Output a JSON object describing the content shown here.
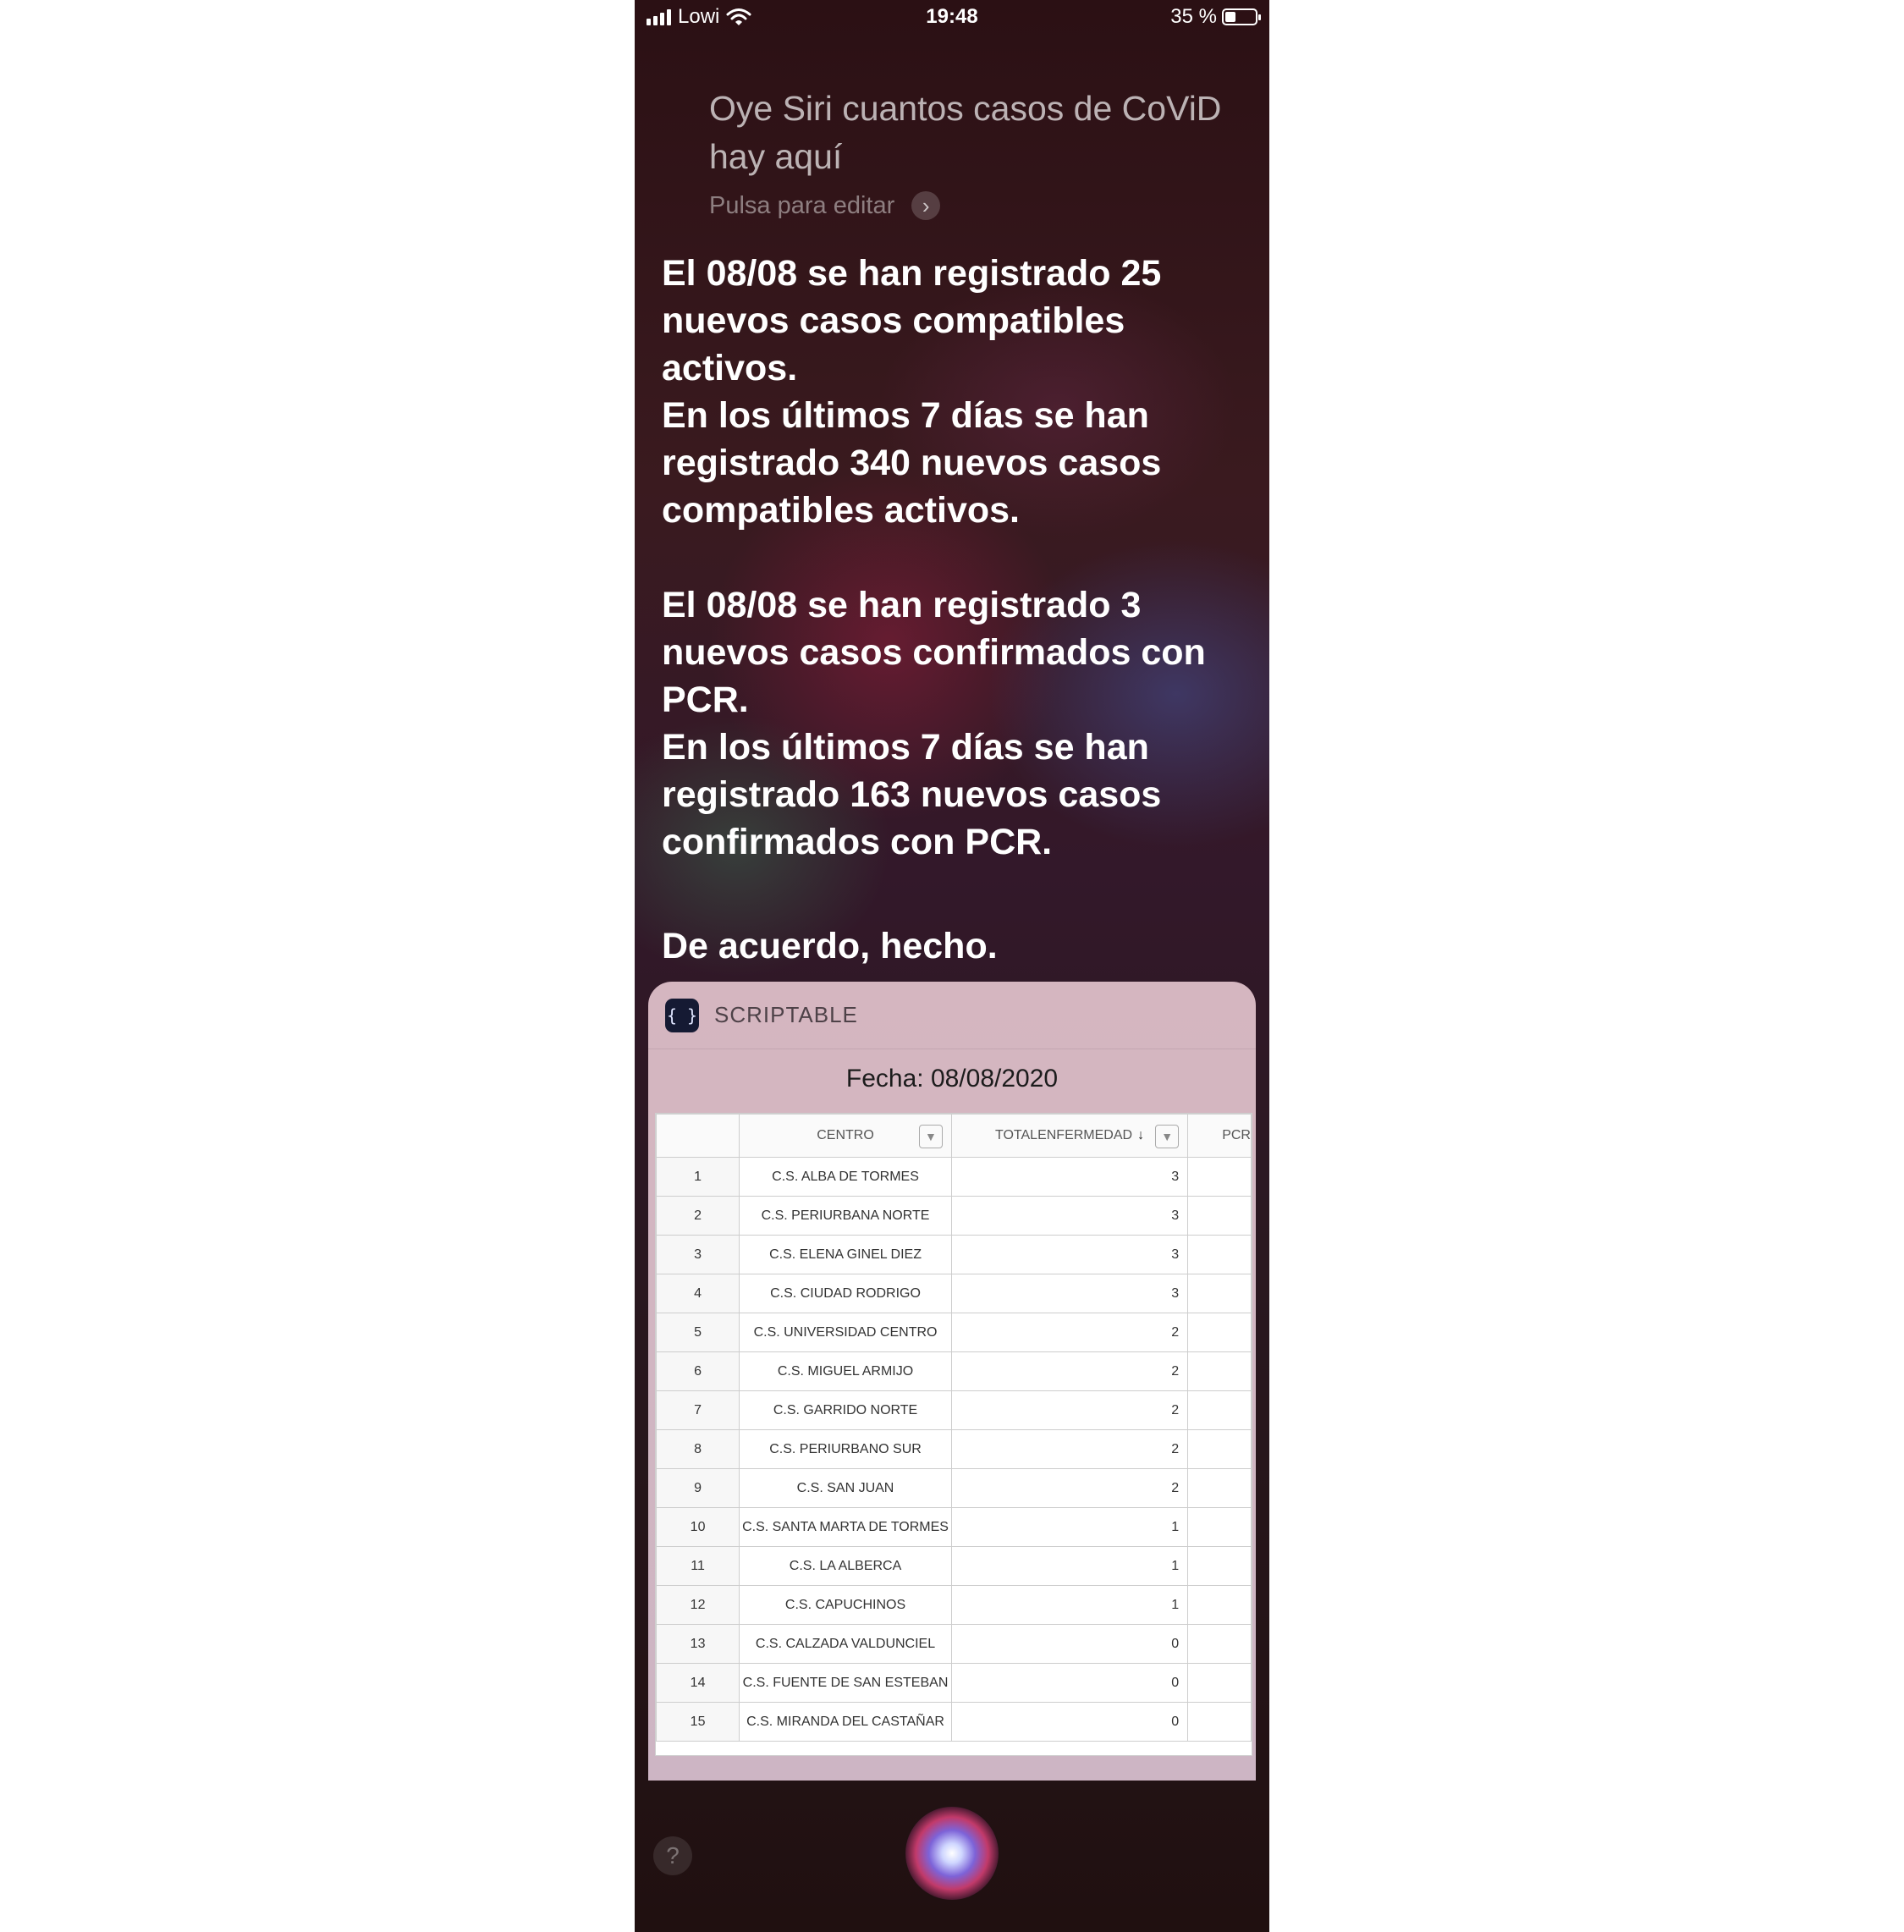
{
  "status_bar": {
    "carrier": "Lowi",
    "time": "19:48",
    "battery": "35 %",
    "battery_level": 0.35
  },
  "query": {
    "text": "Oye Siri cuantos casos de CoViD hay aquí",
    "edit_hint": "Pulsa para editar"
  },
  "answer": {
    "para1_line1": "El 08/08 se han registrado 25 nuevos casos compatibles activos.",
    "para1_line2": "En los últimos 7 días se han registrado 340 nuevos casos compatibles activos.",
    "para2_line1": "El 08/08 se han registrado 3 nuevos casos confirmados con PCR.",
    "para2_line2": "En los últimos 7 días se han registrado 163 nuevos casos confirmados con PCR.",
    "done": "De acuerdo, hecho."
  },
  "card": {
    "app_name": "SCRIPTABLE",
    "app_icon": "curly-braces-icon",
    "fecha": "Fecha: 08/08/2020",
    "columns": {
      "centro": "CENTRO",
      "total": "TOTALENFERMEDAD",
      "pcr": "PCR"
    },
    "rows": [
      {
        "n": "1",
        "centro": "C.S. ALBA DE TORMES",
        "total": "3"
      },
      {
        "n": "2",
        "centro": "C.S. PERIURBANA NORTE",
        "total": "3"
      },
      {
        "n": "3",
        "centro": "C.S. ELENA GINEL DIEZ",
        "total": "3"
      },
      {
        "n": "4",
        "centro": "C.S. CIUDAD RODRIGO",
        "total": "3"
      },
      {
        "n": "5",
        "centro": "C.S. UNIVERSIDAD CENTRO",
        "total": "2"
      },
      {
        "n": "6",
        "centro": "C.S. MIGUEL ARMIJO",
        "total": "2"
      },
      {
        "n": "7",
        "centro": "C.S. GARRIDO NORTE",
        "total": "2"
      },
      {
        "n": "8",
        "centro": "C.S. PERIURBANO SUR",
        "total": "2"
      },
      {
        "n": "9",
        "centro": "C.S. SAN JUAN",
        "total": "2"
      },
      {
        "n": "10",
        "centro": "C.S. SANTA MARTA DE TORMES",
        "total": "1"
      },
      {
        "n": "11",
        "centro": "C.S. LA ALBERCA",
        "total": "1"
      },
      {
        "n": "12",
        "centro": "C.S. CAPUCHINOS",
        "total": "1"
      },
      {
        "n": "13",
        "centro": "C.S. CALZADA VALDUNCIEL",
        "total": "0"
      },
      {
        "n": "14",
        "centro": "C.S. FUENTE DE SAN ESTEBAN",
        "total": "0"
      },
      {
        "n": "15",
        "centro": "C.S. MIRANDA DEL CASTAÑAR",
        "total": "0"
      }
    ]
  },
  "bottom": {
    "help_label": "?"
  }
}
